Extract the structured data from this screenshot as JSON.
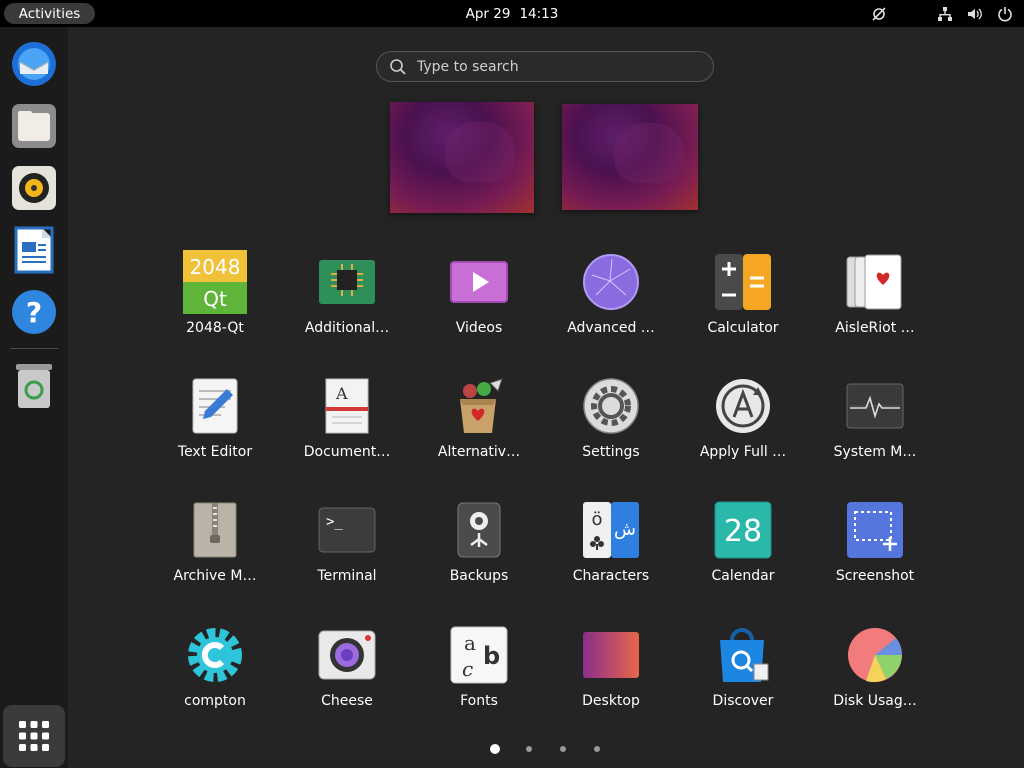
{
  "topbar": {
    "activities": "Activities",
    "date": "Apr 29",
    "time": "14:13",
    "tray_icons": [
      "accessibility-off-icon",
      "network-icon",
      "volume-icon",
      "power-icon"
    ]
  },
  "dock": {
    "items": [
      {
        "name": "Thunderbird Mail",
        "icon": "thunderbird-icon"
      },
      {
        "name": "Files",
        "icon": "files-icon"
      },
      {
        "name": "Rhythmbox",
        "icon": "rhythmbox-icon"
      },
      {
        "name": "LibreOffice Writer",
        "icon": "writer-icon"
      },
      {
        "name": "Help",
        "icon": "help-icon"
      },
      {
        "name": "Trash",
        "icon": "trash-icon"
      }
    ],
    "show_apps_icon": "app-grid-icon"
  },
  "search": {
    "placeholder": "Type to search"
  },
  "apps": [
    {
      "label": "2048-Qt",
      "icon": "2048-icon"
    },
    {
      "label": "Additional…",
      "icon": "chip-icon"
    },
    {
      "label": "Videos",
      "icon": "videos-icon"
    },
    {
      "label": "Advanced …",
      "icon": "advanced-icon"
    },
    {
      "label": "Calculator",
      "icon": "calculator-icon"
    },
    {
      "label": "AisleRiot …",
      "icon": "cards-icon"
    },
    {
      "label": "Text Editor",
      "icon": "text-editor-icon"
    },
    {
      "label": "Document…",
      "icon": "document-viewer-icon"
    },
    {
      "label": "Alternativ…",
      "icon": "alternatives-icon"
    },
    {
      "label": "Settings",
      "icon": "settings-icon"
    },
    {
      "label": "Apply Full …",
      "icon": "upgrade-icon"
    },
    {
      "label": "System M…",
      "icon": "system-monitor-icon"
    },
    {
      "label": "Archive M…",
      "icon": "archive-icon"
    },
    {
      "label": "Terminal",
      "icon": "terminal-icon"
    },
    {
      "label": "Backups",
      "icon": "backups-icon"
    },
    {
      "label": "Characters",
      "icon": "characters-icon"
    },
    {
      "label": "Calendar",
      "icon": "calendar-icon"
    },
    {
      "label": "Screenshot",
      "icon": "screenshot-icon"
    },
    {
      "label": "compton",
      "icon": "compton-icon"
    },
    {
      "label": "Cheese",
      "icon": "cheese-icon"
    },
    {
      "label": "Fonts",
      "icon": "fonts-icon"
    },
    {
      "label": "Desktop",
      "icon": "desktop-icon"
    },
    {
      "label": "Discover",
      "icon": "discover-icon"
    },
    {
      "label": "Disk Usag…",
      "icon": "disk-usage-icon"
    }
  ],
  "icon_text": {
    "game_2048": "2048",
    "game_qt": "Qt",
    "characters_latin": "ö",
    "characters_arabic": "ش",
    "calendar_day": "28",
    "fonts_a": "a",
    "fonts_b": "b",
    "fonts_c": "c",
    "doc_letter": "A",
    "terminal_prompt": ">_"
  },
  "pages": {
    "count": 4,
    "active": 0
  }
}
